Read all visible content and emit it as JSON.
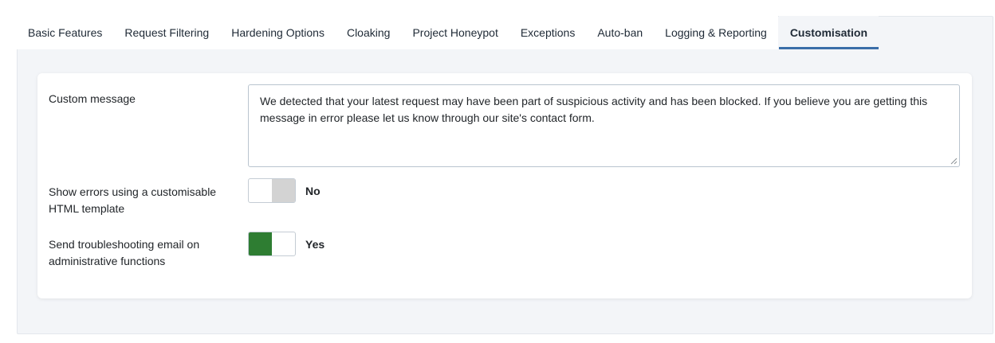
{
  "tabs": [
    {
      "label": "Basic Features"
    },
    {
      "label": "Request Filtering"
    },
    {
      "label": "Hardening Options"
    },
    {
      "label": "Cloaking"
    },
    {
      "label": "Project Honeypot"
    },
    {
      "label": "Exceptions"
    },
    {
      "label": "Auto-ban"
    },
    {
      "label": "Logging & Reporting"
    },
    {
      "label": "Customisation",
      "active": true
    }
  ],
  "form": {
    "custom_message": {
      "label": "Custom message",
      "value": "We detected that your latest request may have been part of suspicious activity and has been blocked. If you believe you are getting this message in error please let us know through our site's contact form."
    },
    "show_errors": {
      "label": "Show errors using a customisable HTML template",
      "state": "No",
      "on": false
    },
    "troubleshooting_email": {
      "label": "Send troubleshooting email on administrative functions",
      "state": "Yes",
      "on": true
    }
  },
  "colors": {
    "accent": "#3a6ea8",
    "toggle_on": "#2e7d32",
    "toggle_off": "#d3d3d3"
  }
}
